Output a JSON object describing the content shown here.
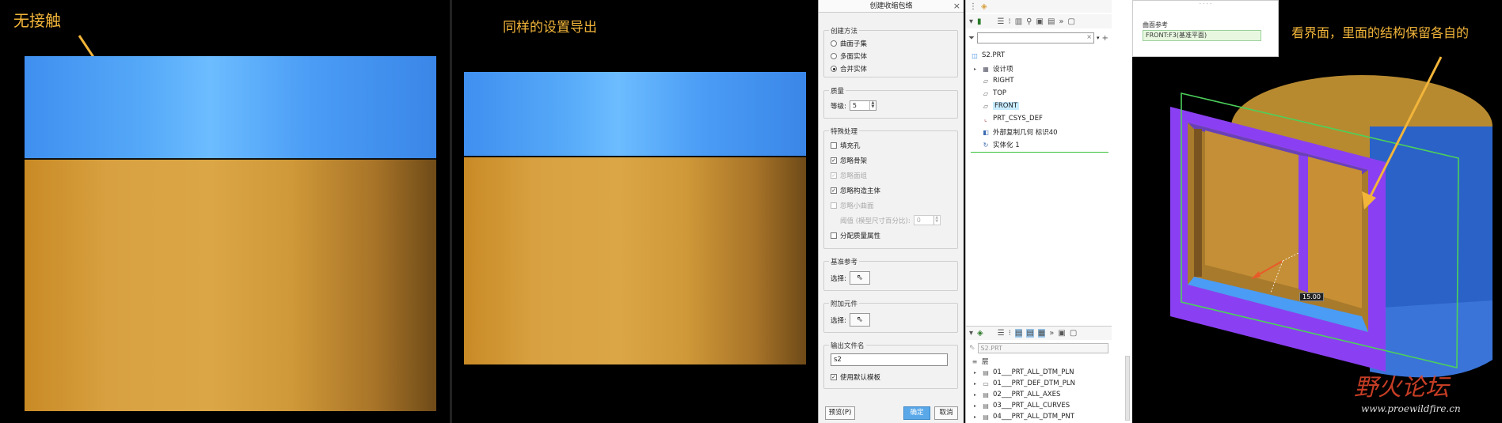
{
  "panel1": {
    "caption": "无接触"
  },
  "panel2": {
    "caption": "同样的设置导出"
  },
  "dialog": {
    "title": "创建收缩包络",
    "close": "×",
    "method": {
      "title": "创建方法",
      "options": [
        {
          "label": "曲面子集",
          "selected": false
        },
        {
          "label": "多面实体",
          "selected": false
        },
        {
          "label": "合并实体",
          "selected": true
        }
      ]
    },
    "quality": {
      "title": "质量",
      "level_label": "等级:",
      "level_value": "5"
    },
    "special": {
      "title": "特殊处理",
      "options": [
        {
          "label": "填充孔",
          "checked": false,
          "enabled": true
        },
        {
          "label": "忽略骨架",
          "checked": true,
          "enabled": true
        },
        {
          "label": "忽略面组",
          "checked": true,
          "enabled": false
        },
        {
          "label": "忽略构造主体",
          "checked": true,
          "enabled": true
        },
        {
          "label": "忽略小曲面",
          "checked": false,
          "enabled": false
        }
      ],
      "threshold_label": "阈值 (模型尺寸百分比):",
      "threshold_value": "0",
      "assign_mass": "分配质量属性"
    },
    "datum_ref": {
      "title": "基准参考",
      "select_label": "选择:"
    },
    "additional": {
      "title": "附加元件",
      "select_label": "选择:"
    },
    "output": {
      "title": "输出文件名",
      "filename": "s2",
      "use_template": "使用默认模板"
    },
    "buttons": {
      "preview": "预览(P)",
      "ok": "确定",
      "cancel": "取消"
    }
  },
  "model_tree": {
    "root": "S2.PRT",
    "items": [
      {
        "label": "设计项",
        "icon": "design-items-icon",
        "expandable": true
      },
      {
        "label": "RIGHT",
        "icon": "datum-plane-icon",
        "expandable": false
      },
      {
        "label": "TOP",
        "icon": "datum-plane-icon",
        "expandable": false
      },
      {
        "label": "FRONT",
        "icon": "datum-plane-icon",
        "expandable": false,
        "highlighted": true
      },
      {
        "label": "PRT_CSYS_DEF",
        "icon": "csys-icon",
        "expandable": false
      },
      {
        "label": "外部复制几何 标识40",
        "icon": "copy-geom-icon",
        "expandable": false
      },
      {
        "label": "实体化 1",
        "icon": "solidify-icon",
        "expandable": false
      }
    ]
  },
  "layer_tree": {
    "active_model": "S2.PRT",
    "root": "层",
    "items": [
      "01___PRT_ALL_DTM_PLN",
      "01___PRT_DEF_DTM_PLN",
      "02___PRT_ALL_AXES",
      "03___PRT_ALL_CURVES",
      "04___PRT_ALL_DTM_PNT"
    ]
  },
  "ref_panel": {
    "dots": "· · · ·",
    "label": "曲面参考",
    "value": "FRONT:F3(基准平面)"
  },
  "panel5": {
    "caption": "看界面，里面的结构保留各自的",
    "dimension": "15.00",
    "watermark_cn": "野火论坛",
    "watermark_url": "www.proewildfire.cn"
  },
  "colors": {
    "caption": "#f2b53a",
    "blue": "#4a9cf5",
    "gold": "#d8a040",
    "purple": "#8840f0",
    "highlight": "#c8ecff"
  }
}
